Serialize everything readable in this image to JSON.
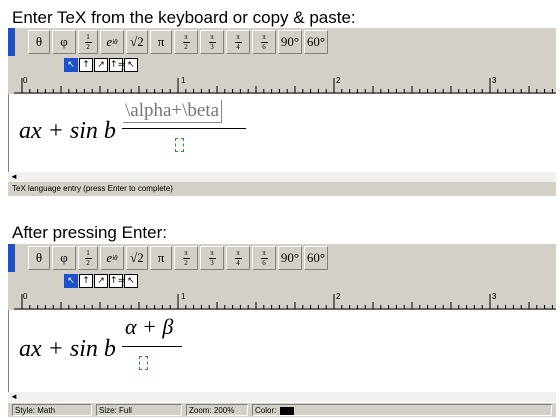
{
  "captions": {
    "top": "Enter TeX from the keyboard or copy & paste:",
    "bottom": "After pressing Enter:"
  },
  "toolbar": {
    "symbols": [
      "θ",
      "φ",
      "1/2",
      "e^θ",
      "√2",
      "π",
      "π/2",
      "π/3",
      "π/4",
      "π/6",
      "90°",
      "60°"
    ],
    "symbol_text": {
      "theta": "θ",
      "phi": "φ",
      "half_num": "1",
      "half_den": "2",
      "exp": "e",
      "exp_sup": "iθ",
      "sqrt": "√2",
      "pi": "π",
      "pi_num": "π",
      "d2": "2",
      "d3": "3",
      "d4": "4",
      "d6": "6",
      "deg90": "90°",
      "deg60": "60°"
    },
    "small_buttons": [
      "↖",
      "↑",
      "↗",
      "↑=",
      "↖"
    ]
  },
  "ruler": {
    "numbers": [
      "0",
      "1",
      "2",
      "3"
    ]
  },
  "before": {
    "math_prefix": "ax + sin b",
    "tex_input": "\\alpha+\\beta"
  },
  "after": {
    "math_prefix": "ax + sin b",
    "result": "α + β"
  },
  "status_top": {
    "text": "TeX language entry (press Enter to complete)"
  },
  "status_bottom": {
    "style": "Style: Math",
    "size": "Size: Full",
    "zoom": "Zoom: 200%",
    "color": "Color:"
  },
  "colors": {
    "accent": "#1c50c8",
    "toolbar_bg": "#d4d0c8",
    "slot": "#2a9a2a"
  }
}
